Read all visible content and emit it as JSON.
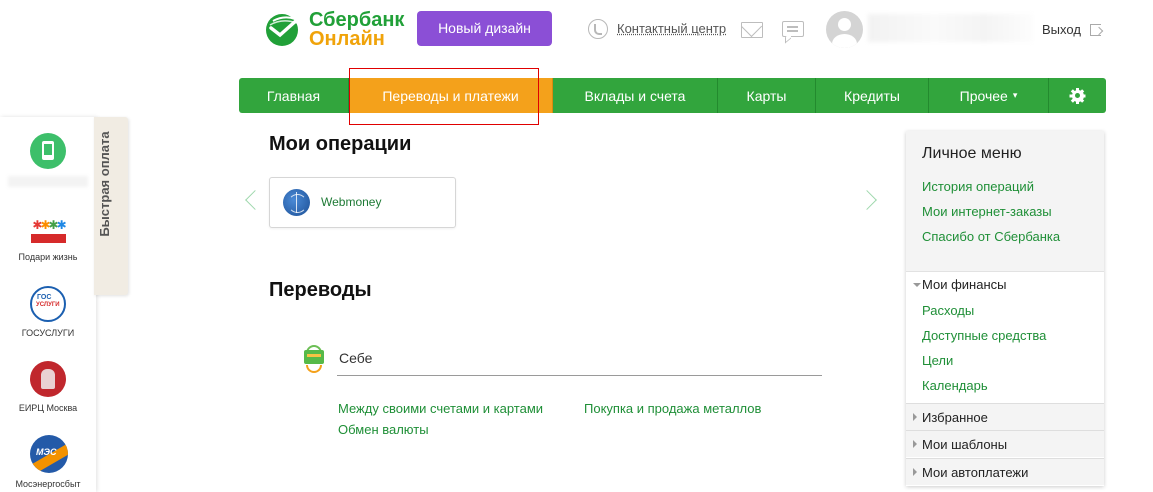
{
  "header": {
    "logo_line1": "Сбербанк",
    "logo_line2": "Онлайн",
    "new_design_label": "Новый дизайн",
    "contact_center_label": "Контактный центр",
    "logout_label": "Выход"
  },
  "nav": {
    "tabs": [
      {
        "label": "Главная"
      },
      {
        "label": "Переводы и платежи",
        "active": true
      },
      {
        "label": "Вклады и счета"
      },
      {
        "label": "Карты"
      },
      {
        "label": "Кредиты"
      },
      {
        "label": "Прочее",
        "dropdown": true
      }
    ],
    "settings_icon": "gear-icon"
  },
  "quick_pay": {
    "tab_label": "Быстрая оплата",
    "items": [
      {
        "label": "Подари жизнь",
        "icon": "podari-zhizn-logo"
      },
      {
        "label": "ГОСУСЛУГИ",
        "icon": "gosuslugi-logo"
      },
      {
        "label": "ЕИРЦ Москва",
        "icon": "eirc-moscow-logo"
      },
      {
        "label": "Мосэнергосбыт",
        "icon": "mosenergosbyt-logo"
      }
    ],
    "mes_logo_text": "МЭС"
  },
  "operations": {
    "title": "Мои операции",
    "items": [
      {
        "label": "Webmoney",
        "icon": "webmoney-icon"
      }
    ]
  },
  "transfers": {
    "title": "Переводы",
    "self_label": "Себе",
    "links": [
      "Между своими счетами и картами",
      "Покупка и продажа металлов",
      "Обмен валюты"
    ]
  },
  "side_menu": {
    "title": "Личное меню",
    "top_links": [
      "История операций",
      "Мои интернет-заказы",
      "Спасибо от Сбербанка"
    ],
    "finances_title": "Мои финансы",
    "finance_links": [
      "Расходы",
      "Доступные средства",
      "Цели",
      "Календарь"
    ],
    "sections": [
      "Избранное",
      "Мои шаблоны",
      "Мои автоплатежи"
    ]
  },
  "colors": {
    "brand_green": "#32a53d",
    "active_tab": "#f4a11b",
    "new_design_purple": "#8b4fd6",
    "link_green": "#1f8f37",
    "highlight_red": "#e00000"
  }
}
